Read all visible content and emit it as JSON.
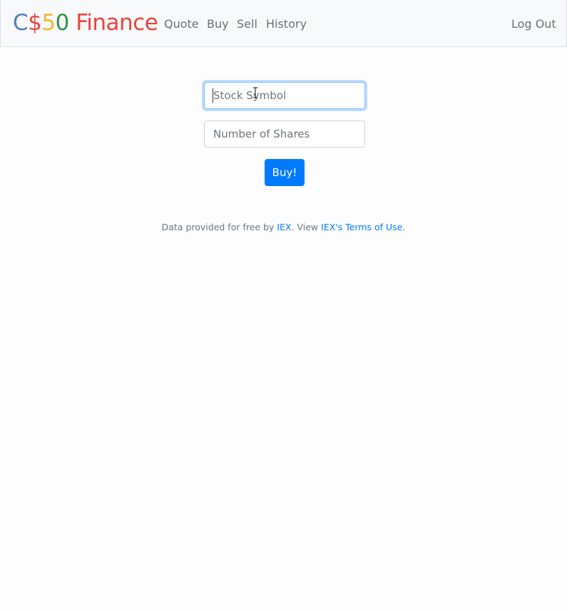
{
  "navbar": {
    "brand": {
      "parts": [
        {
          "text": "C",
          "color": "#537fbe"
        },
        {
          "text": "$",
          "color": "#ea433b"
        },
        {
          "text": "5",
          "color": "#f5b82e"
        },
        {
          "text": "0",
          "color": "#2e944b"
        },
        {
          "text": " Finance",
          "color": "#ea433b"
        }
      ]
    },
    "links": {
      "quote": "Quote",
      "buy": "Buy",
      "sell": "Sell",
      "history": "History"
    },
    "logout": "Log Out"
  },
  "form": {
    "symbol_placeholder": "Stock Symbol",
    "symbol_value": "",
    "shares_placeholder": "Number of Shares",
    "shares_value": "",
    "submit_label": "Buy!"
  },
  "footer": {
    "text_before": "Data provided for free by ",
    "iex_link": "IEX",
    "text_middle": ". View ",
    "terms_link": "IEX's Terms of Use",
    "text_after": "."
  },
  "colors": {
    "primary": "#007bff",
    "navbar_bg": "#f8f9fb",
    "focus_border": "#80bdff"
  }
}
